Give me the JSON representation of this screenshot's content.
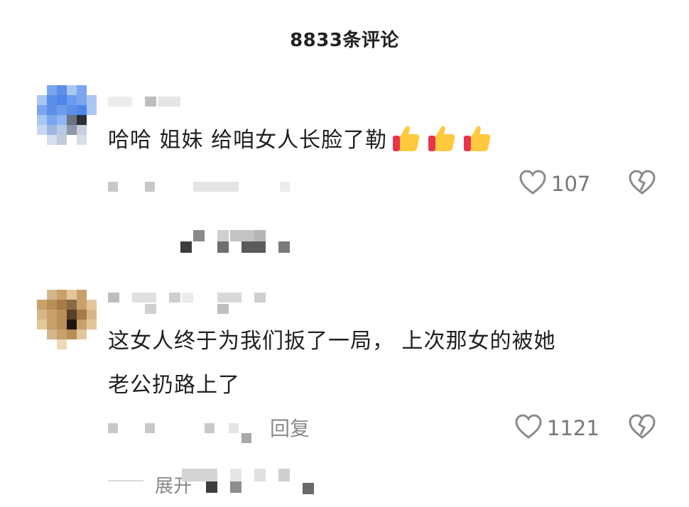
{
  "header": {
    "title": "8833条评论"
  },
  "comments": [
    {
      "text": "哈哈 姐妹 给咱女人长脸了勒",
      "emoji": "thumbs-up x3",
      "likes": "107"
    },
    {
      "text_line1": "这女人终于为我们扳了一局， 上次那女的被她",
      "text_line2": "老公扔路上了",
      "reply_label": "回复",
      "likes": "1121"
    }
  ],
  "footer": {
    "expand_label": "展开"
  },
  "colors": {
    "heart": "#8a8a8a",
    "avatar1": [
      "#5b8fe8",
      "#a9c7f5",
      "#7aa6ef",
      "#2a2f3a"
    ],
    "avatar2": [
      "#c8a06a",
      "#e3c79a",
      "#a57a45",
      "#1b1510"
    ]
  }
}
